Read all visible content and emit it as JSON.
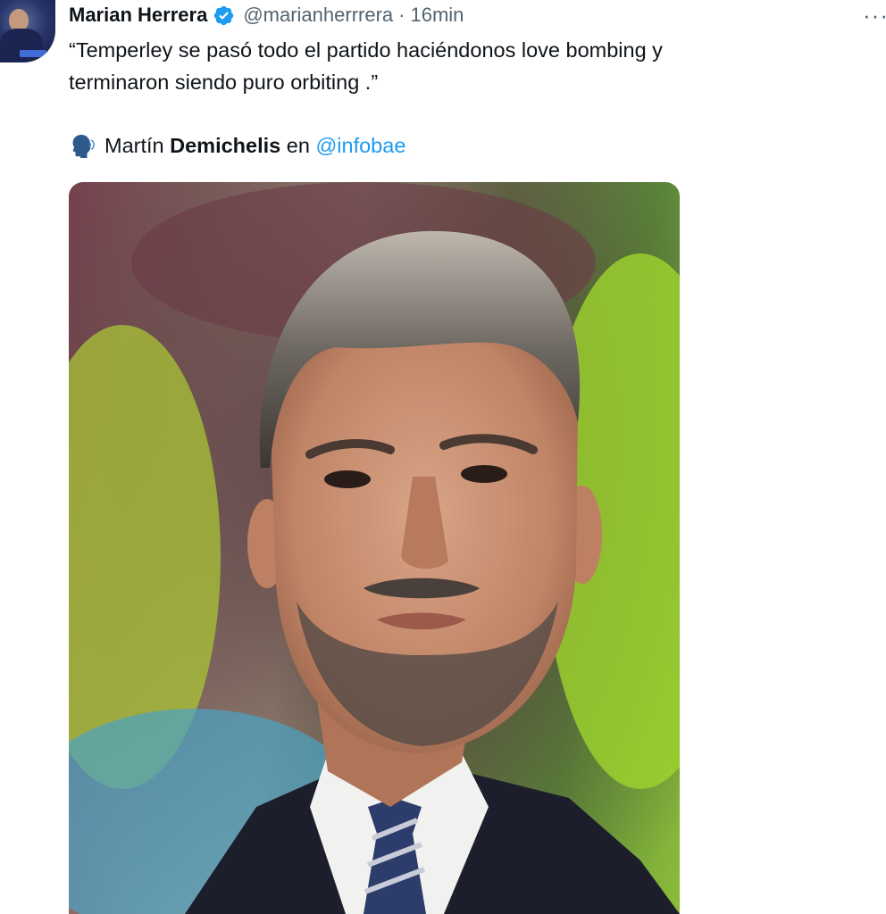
{
  "author": {
    "name": "Marian Herrera",
    "handle": "@marianherrrera",
    "separator": "·",
    "time": "16min",
    "verified_icon": "verified-badge-icon",
    "verified_color": "#1d9bf0"
  },
  "more_icon": "more-options-icon",
  "tweet": {
    "line1": "“Temperley se pasó todo el partido haciéndonos love bombing y",
    "line2": "terminaron siendo puro orbiting .”"
  },
  "attribution": {
    "icon": "speaking-head-icon",
    "first_name": "Martín",
    "last_name": "Demichelis",
    "connector": "en",
    "mention": "@infobae",
    "mention_color": "#1d9bf0"
  },
  "media": {
    "image_icon": "portrait-photo"
  }
}
